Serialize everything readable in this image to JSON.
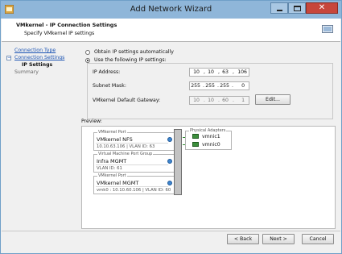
{
  "window": {
    "title": "Add Network Wizard",
    "close_glyph": "✕"
  },
  "header": {
    "title": "VMkernel - IP Connection Settings",
    "subtitle": "Specify VMkernel IP settings"
  },
  "sidebar": {
    "items": [
      {
        "label": "Connection Type",
        "state": "link"
      },
      {
        "label": "Connection Settings",
        "state": "link",
        "expander": "⊟"
      },
      {
        "label": "IP Settings",
        "state": "current"
      },
      {
        "label": "Summary",
        "state": "pending"
      }
    ]
  },
  "ip_settings": {
    "auto_label": "Obtain IP settings automatically",
    "manual_label": "Use the following IP settings:",
    "selected": "manual",
    "ip_label": "IP Address:",
    "ip": [
      "10",
      "10",
      "63",
      "106"
    ],
    "mask_label": "Subnet Mask:",
    "mask": [
      "255",
      "255",
      "255",
      "0"
    ],
    "gateway_label": "VMkernel Default Gateway:",
    "gateway": [
      "10",
      "10",
      "60",
      "1"
    ],
    "edit_label": "Edit..."
  },
  "preview": {
    "label": "Preview:",
    "port_groups": [
      {
        "caption": "VMkernel Port",
        "name": "VMkernel NFS",
        "detail": "10.10.63.106 | VLAN ID: 63"
      },
      {
        "caption": "Virtual Machine Port Group",
        "name": "Infra MGMT",
        "detail": "VLAN ID: 61"
      },
      {
        "caption": "VMkernel Port",
        "name": "VMkernel MGMT",
        "detail": "vmk0 : 10.10.60.106 | VLAN ID: 60"
      }
    ],
    "adapters_caption": "Physical Adapters",
    "adapters": [
      "vmnic1",
      "vmnic0"
    ]
  },
  "footer": {
    "back_label": "< Back",
    "next_label": "Next >",
    "cancel_label": "Cancel"
  },
  "colors": {
    "title_bar": "#8fb6d9",
    "close_button": "#c7463b",
    "link": "#1b53b3",
    "adapter_green": "#2b8b2b"
  }
}
